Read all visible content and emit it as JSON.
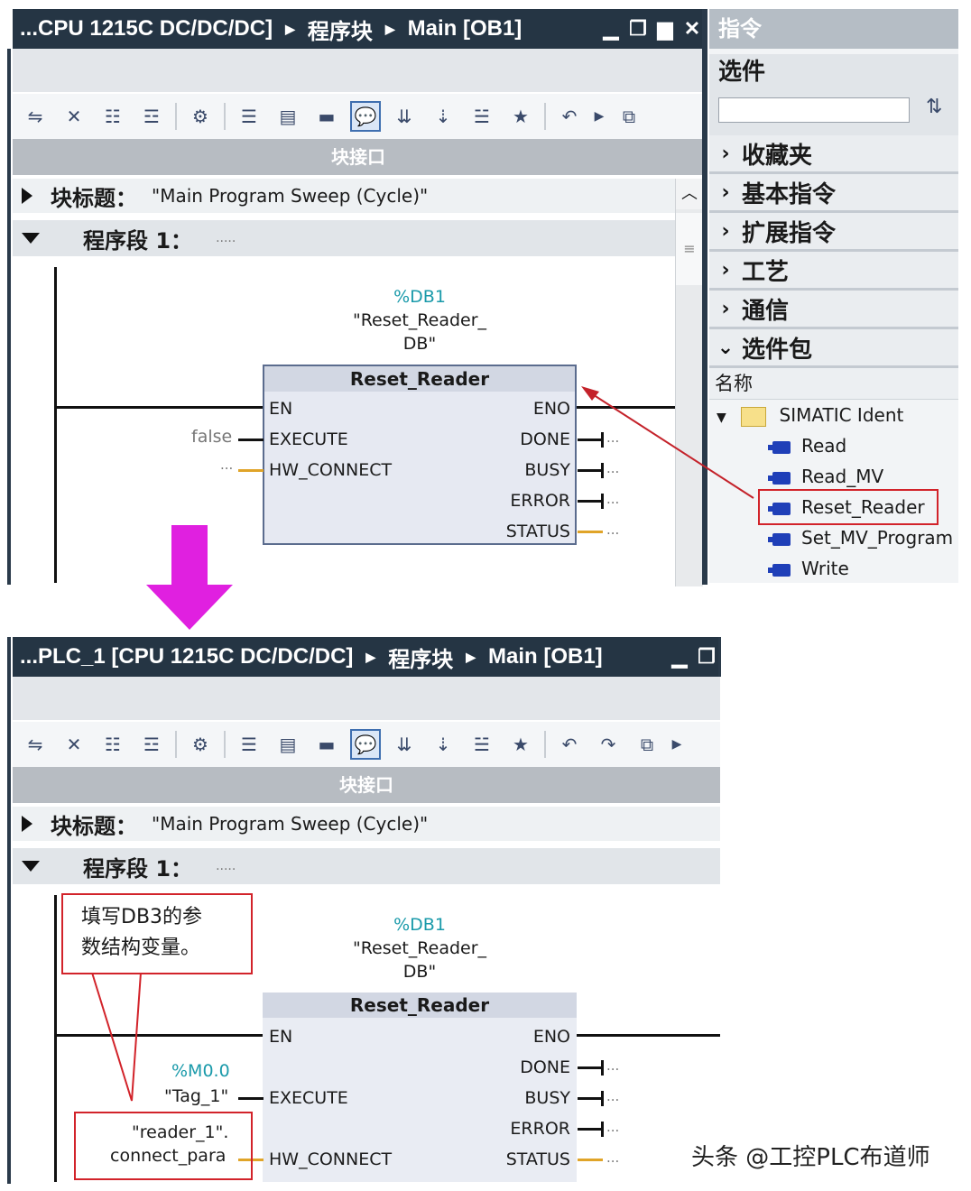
{
  "top": {
    "breadcrumb": [
      "...CPU 1215C DC/DC/DC]",
      "程序块",
      "Main [OB1]"
    ],
    "window_buttons": [
      "▁",
      "❐",
      "▆",
      "✕"
    ],
    "interface_label": "块接口",
    "block_title_label": "块标题：",
    "block_title_value": "\"Main Program Sweep (Cycle)\"",
    "network_label": "程序段 1：",
    "network_comment": ".....",
    "instance_db": {
      "address": "%DB1",
      "name_line1": "\"Reset_Reader_",
      "name_line2": "DB\""
    },
    "block_name": "Reset_Reader",
    "inputs": [
      "EN",
      "EXECUTE",
      "HW_CONNECT"
    ],
    "outputs": [
      "ENO",
      "DONE",
      "BUSY",
      "ERROR",
      "STATUS"
    ],
    "execute_value": "false",
    "hw_connect_value": "...",
    "output_placeholder": "..."
  },
  "right_panel": {
    "header": "指令",
    "options_label": "选件",
    "search_placeholder": "",
    "categories": [
      "收藏夹",
      "基本指令",
      "扩展指令",
      "工艺",
      "通信",
      "选件包"
    ],
    "name_header": "名称",
    "folder": "SIMATIC Ident",
    "items": [
      "Read",
      "Read_MV",
      "Reset_Reader",
      "Set_MV_Program",
      "Write"
    ],
    "highlighted_item": "Reset_Reader"
  },
  "bottom": {
    "breadcrumb": [
      "...PLC_1 [CPU 1215C DC/DC/DC]",
      "程序块",
      "Main [OB1]"
    ],
    "window_buttons": [
      "▁",
      "❐"
    ],
    "interface_label": "块接口",
    "block_title_label": "块标题：",
    "block_title_value": "\"Main Program Sweep (Cycle)\"",
    "network_label": "程序段 1：",
    "network_comment": ".....",
    "callout_line1": "填写DB3的参",
    "callout_line2": "数结构变量。",
    "instance_db": {
      "address": "%DB1",
      "name_line1": "\"Reset_Reader_",
      "name_line2": "DB\""
    },
    "block_name": "Reset_Reader",
    "inputs": [
      "EN",
      "EXECUTE",
      "HW_CONNECT"
    ],
    "outputs": [
      "ENO",
      "DONE",
      "BUSY",
      "ERROR",
      "STATUS"
    ],
    "execute_address": "%M0.0",
    "execute_tag": "\"Tag_1\"",
    "hw_connect_line1": "\"reader_1\".",
    "hw_connect_line2": "connect_para",
    "output_placeholder": "..."
  },
  "watermark": "头条 @工控PLC布道师",
  "colors": {
    "titlebar": "#253544",
    "arrow": "#e020e0",
    "highlight": "#d2232a",
    "cyan": "#1a9aaa"
  }
}
